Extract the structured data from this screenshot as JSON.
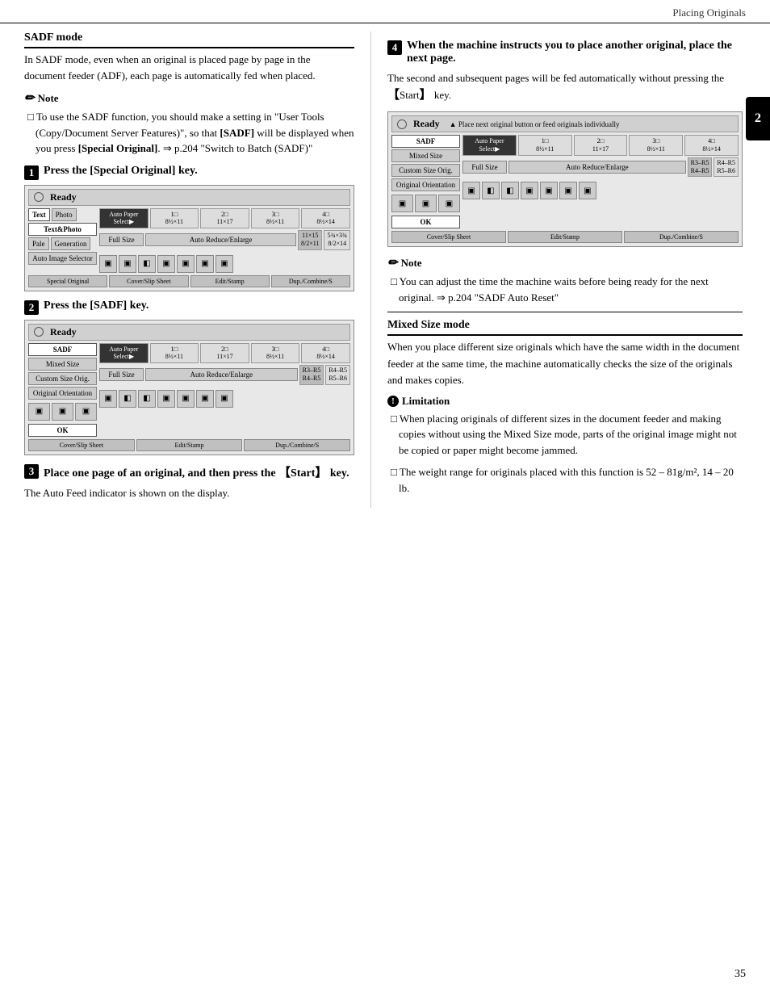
{
  "header": {
    "title": "Placing Originals",
    "page_number": "35"
  },
  "chapter_tab": "2",
  "left_column": {
    "section_heading": "SADF mode",
    "intro_text": "In SADF mode, even when an original is placed page by page in the document feeder (ADF), each page is automatically fed when placed.",
    "note": {
      "title": "Note",
      "items": [
        "To use the SADF function, you should make a setting in \"User Tools (Copy/Document Server Features)\", so that [SADF] will be displayed when you press [Special Original]. ⇒ p.204 \"Switch to Batch (SADF)\""
      ]
    },
    "step1": {
      "num": "1",
      "heading": "Press the [Special Original] key."
    },
    "step2": {
      "num": "2",
      "heading": "Press the [SADF] key."
    },
    "step3": {
      "num": "3",
      "heading": "Place one page of an original, and then press the 【Start】 key.",
      "body": "The Auto Feed indicator is shown on the display."
    },
    "screen1": {
      "ready": "Ready",
      "tab1": "Text",
      "tab2": "Photo",
      "btn1": "Text&Photo",
      "btn2": "Pale",
      "btn3": "Generation",
      "auto_image": "Auto Image Selector",
      "full_size": "Full Size",
      "auto_reduce": "Auto Reduce/Enlarge",
      "size1": "11×15\n8/2×11",
      "size2": "5¾×3¾\n8/2×14",
      "bottom_tabs": [
        "Cover/Slip Sheet",
        "Edit/Stamp",
        "Dup./Combine/S"
      ],
      "special_original": "Special Original"
    },
    "screen2": {
      "ready": "Ready",
      "left_btns": [
        "SADF",
        "Mixed Size",
        "Custom Size Orig.",
        "Original Orientation"
      ],
      "auto_paper": "Auto Paper\nSelect▶",
      "full_size": "Full Size",
      "auto_reduce": "Auto Reduce/Enlarge",
      "ok_btn": "OK",
      "bottom_tabs": [
        "Cover/Slip Sheet",
        "Edit/Stamp",
        "Dup./Combine/S"
      ],
      "paper_sizes": [
        "1□\n8½×11",
        "2□\n11×17",
        "3□\n8½×11",
        "4□\n8½×14"
      ]
    }
  },
  "right_column": {
    "step4": {
      "num": "4",
      "heading": "When the machine instructs you to place another original, place the next page."
    },
    "step4_body": "The second and subsequent pages will be fed automatically without pressing the 【Start】 key.",
    "screen3": {
      "ready": "Ready",
      "note_text": "Place next original button or feed originals individually",
      "left_btns": [
        "SADF",
        "Mixed Size",
        "Custom Size Orig.",
        "Original Orientation"
      ],
      "auto_paper": "Auto Paper\nSelect▶",
      "full_size": "Full Size",
      "auto_reduce": "Auto Reduce/Enlarge",
      "ok_btn": "OK",
      "bottom_tabs": [
        "Cover/Slip Sheet",
        "Edit/Stamp",
        "Dup./Combine/S"
      ],
      "paper_sizes": [
        "1□\n8½×11",
        "2□\n11×17",
        "3□\n8½×11",
        "4□\n8½×14"
      ]
    },
    "note2": {
      "title": "Note",
      "items": [
        "You can adjust the time the machine waits before being ready for the next original. ⇒ p.204 \"SADF Auto Reset\""
      ]
    },
    "mixed_size": {
      "heading": "Mixed Size mode",
      "body": "When you place different size originals which have the same width in the document feeder at the same time, the machine automatically checks the size of the originals and makes copies."
    },
    "limitation": {
      "title": "Limitation",
      "items": [
        "When placing originals of different sizes in the document feeder and making copies without using the Mixed Size mode, parts of the original image might not be copied or paper might become jammed.",
        "The weight range for originals placed with this function is 52 – 81g/m², 14 – 20 lb."
      ]
    }
  }
}
